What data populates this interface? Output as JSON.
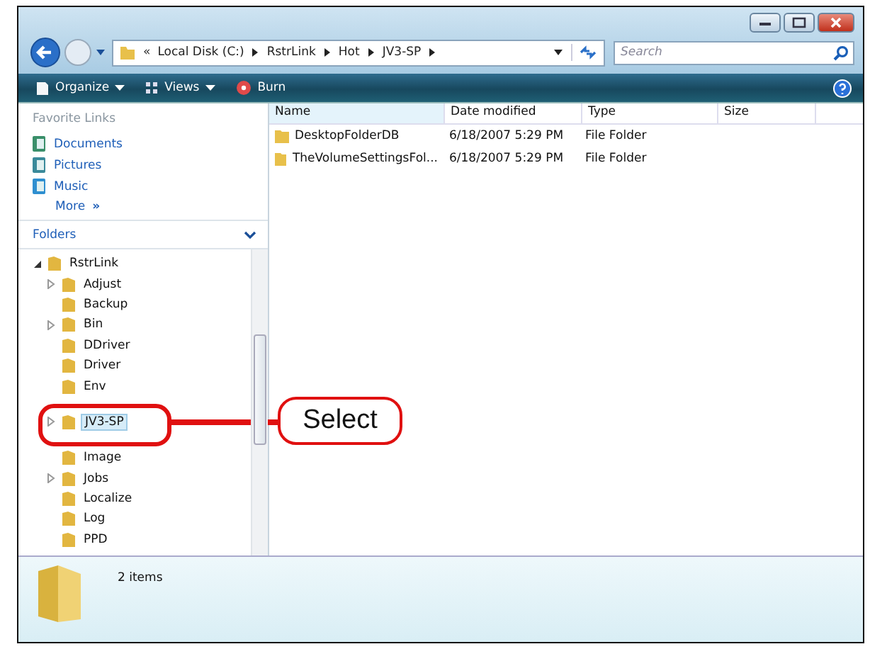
{
  "address_bar": {
    "overflow": "«",
    "crumbs": [
      "Local Disk (C:)",
      "RstrLink",
      "Hot",
      "JV3-SP"
    ],
    "search": {
      "placeholder": "Search"
    }
  },
  "toolbar": {
    "items": [
      {
        "label": "Organize",
        "kind": "organize"
      },
      {
        "label": "Views",
        "kind": "views"
      },
      {
        "label": "Burn",
        "kind": "burn"
      }
    ]
  },
  "favorite_links": {
    "title": "Favorite Links",
    "items": [
      {
        "label": "Documents",
        "kind": "documents"
      },
      {
        "label": "Pictures",
        "kind": "pictures"
      },
      {
        "label": "Music",
        "kind": "music"
      }
    ],
    "more": "More",
    "more_glyph": "»"
  },
  "folders": {
    "title": "Folders",
    "tree": [
      {
        "label": "RstrLink",
        "expanded": true,
        "children": [
          {
            "label": "Adjust",
            "expandable": true,
            "selected": false
          },
          {
            "label": "Backup",
            "expandable": false,
            "selected": false
          },
          {
            "label": "Bin",
            "expandable": true,
            "selected": false
          },
          {
            "label": "DDriver",
            "expandable": false,
            "selected": false
          },
          {
            "label": "Driver",
            "expandable": false,
            "selected": false
          },
          {
            "label": "Env",
            "expandable": false,
            "selected": false
          },
          {
            "label": "JV3-SP",
            "expandable": true,
            "selected": true,
            "callout": "Select"
          },
          {
            "label": "Image",
            "expandable": false,
            "selected": false
          },
          {
            "label": "Jobs",
            "expandable": true,
            "selected": false
          },
          {
            "label": "Localize",
            "expandable": false,
            "selected": false
          },
          {
            "label": "Log",
            "expandable": false,
            "selected": false
          },
          {
            "label": "PPD",
            "expandable": false,
            "selected": false
          }
        ]
      }
    ]
  },
  "table": {
    "columns": [
      "Name",
      "Date modified",
      "Type",
      "Size"
    ],
    "rows": [
      {
        "name": "DesktopFolderDB",
        "date": "6/18/2007 5:29 PM",
        "type": "File Folder"
      },
      {
        "name": "TheVolumeSettingsFol...",
        "date": "6/18/2007 5:29 PM",
        "type": "File Folder"
      }
    ]
  },
  "details_pane": {
    "count": "2 items"
  }
}
